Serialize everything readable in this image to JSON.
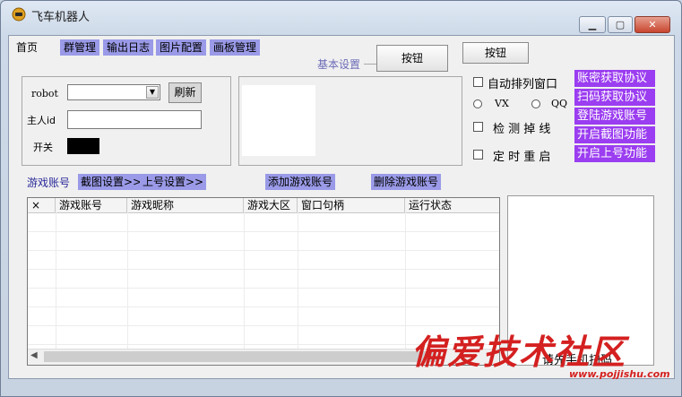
{
  "window": {
    "title": "飞车机器人"
  },
  "tabs": [
    {
      "label": "首页"
    },
    {
      "label": "群管理"
    },
    {
      "label": "输出日志"
    },
    {
      "label": "图片配置"
    },
    {
      "label": "画板管理"
    }
  ],
  "top_buttons": {
    "button1": "按钮",
    "button2": "按钮"
  },
  "basic_settings": {
    "legend": "基本设置"
  },
  "robot": {
    "label": "robot",
    "value": "",
    "refresh": "刷新"
  },
  "master": {
    "label": "主人id",
    "value": ""
  },
  "switch": {
    "label": "开关",
    "color": "#000000"
  },
  "options": {
    "auto_arrange": "自动排列窗口",
    "vx": "VX",
    "qq": "QQ",
    "detect_drop": "检 测 掉 线",
    "timed_restart": "定 时 重 启"
  },
  "purple_buttons": [
    "账密获取协议",
    "扫码获取协议",
    "登陆游戏账号",
    "开启截图功能",
    "开启上号功能"
  ],
  "account_bar": {
    "label": "游戏账号",
    "screenshot_settings": "截图设置>>",
    "login_settings": "上号设置>>",
    "add_account": "添加游戏账号",
    "delete_account": "删除游戏账号"
  },
  "grid": {
    "columns": [
      "×",
      "游戏账号",
      "游戏昵称",
      "游戏大区",
      "窗口句柄",
      "运行状态"
    ]
  },
  "log_panel": {
    "text": "请先手机扫码"
  },
  "watermark": {
    "text": "偏爱技术社区",
    "url": "www.pojjishu.com"
  },
  "colors": {
    "tab_accent": "#9a9ae8",
    "purple_button": "#9b3df0",
    "watermark": "#d42020"
  }
}
